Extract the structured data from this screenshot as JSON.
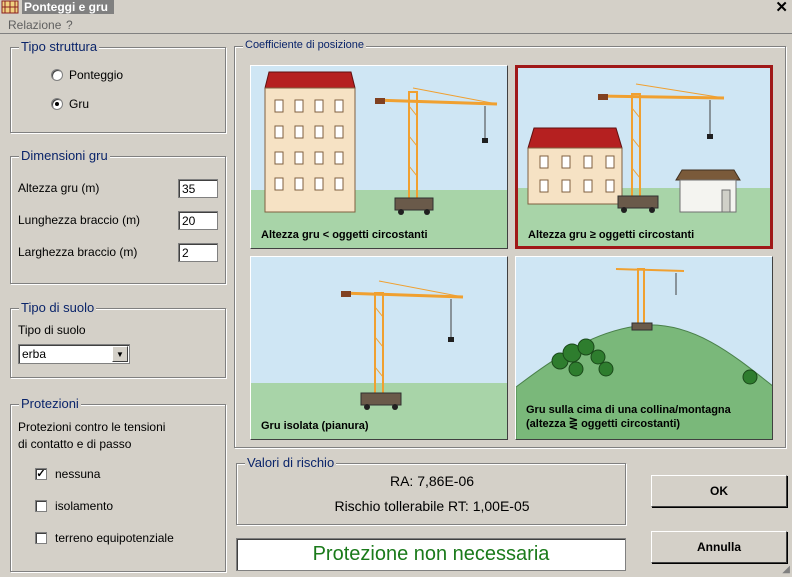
{
  "window": {
    "title": "Ponteggi e gru",
    "close_glyph": "✕"
  },
  "menu": {
    "items": [
      "Relazione",
      "?"
    ]
  },
  "tipo_struttura": {
    "title": "Tipo struttura",
    "options": [
      {
        "label": "Ponteggio",
        "selected": false
      },
      {
        "label": "Gru",
        "selected": true
      }
    ]
  },
  "dimensioni_gru": {
    "title": "Dimensioni gru",
    "fields": [
      {
        "label": "Altezza gru (m)",
        "value": "35"
      },
      {
        "label": "Lunghezza braccio (m)",
        "value": "20"
      },
      {
        "label": "Larghezza braccio (m)",
        "value": "2"
      }
    ]
  },
  "tipo_suolo": {
    "title": "Tipo di suolo",
    "label": "Tipo di suolo",
    "value": "erba"
  },
  "protezioni": {
    "title": "Protezioni",
    "description_line1": "Protezioni contro le tensioni",
    "description_line2": "di contatto e di passo",
    "options": [
      {
        "label": "nessuna",
        "checked": true
      },
      {
        "label": "isolamento",
        "checked": false
      },
      {
        "label": "terreno equipotenziale",
        "checked": false
      }
    ]
  },
  "coefficiente": {
    "title": "Coefficiente di posizione",
    "scenes": [
      {
        "caption": "Altezza gru < oggetti circostanti",
        "selected": false
      },
      {
        "caption": "Altezza gru ≥ oggetti circostanti",
        "selected": true
      },
      {
        "caption": "Gru isolata (pianura)",
        "selected": false
      },
      {
        "caption_line1": "Gru sulla cima di una collina/montagna",
        "caption_line2": "(altezza ⋛ oggetti circostanti)",
        "selected": false
      }
    ]
  },
  "rischio": {
    "title": "Valori di rischio",
    "ra": "RA: 7,86E-06",
    "rt": "Rischio tollerabile RT: 1,00E-05"
  },
  "status": {
    "text": "Protezione non necessaria",
    "color": "#1a7a1a"
  },
  "buttons": {
    "ok": "OK",
    "cancel": "Annulla"
  },
  "colors": {
    "selected_border": "#a01818",
    "sky": "#cfe6f4",
    "grass": "#a8d4a8",
    "crane": "#f0a030",
    "roof": "#b52020"
  },
  "icons": {
    "app": "scaffold-icon",
    "close": "close-icon",
    "dropdown": "chevron-down-icon",
    "check": "check-icon"
  }
}
